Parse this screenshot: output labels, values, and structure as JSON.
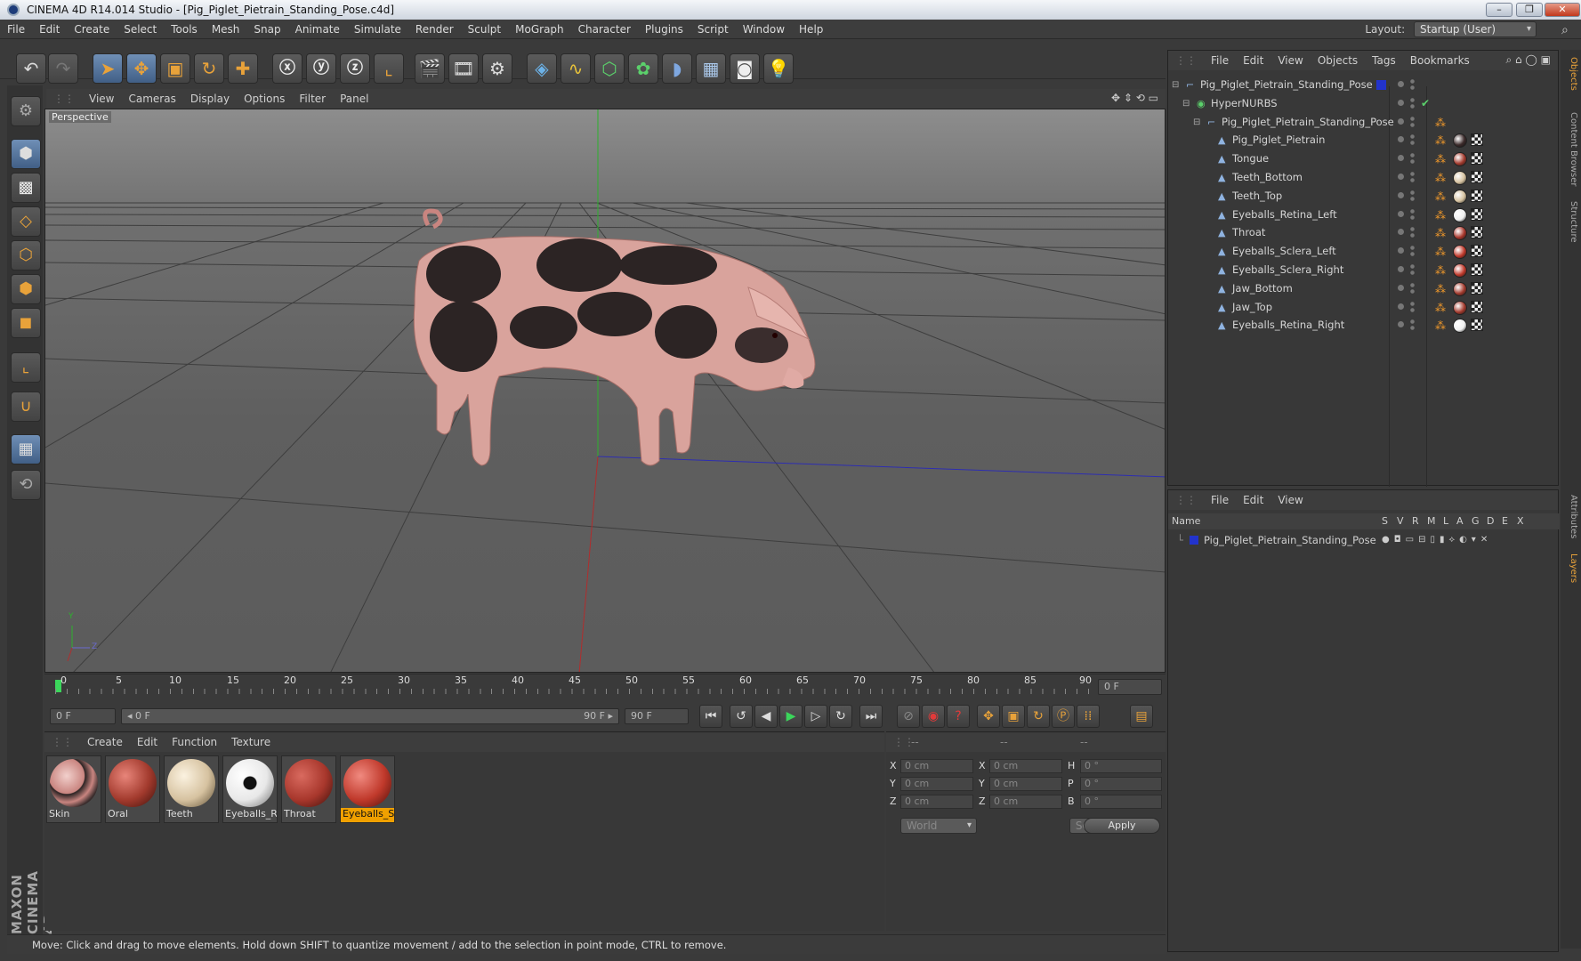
{
  "window": {
    "title": "CINEMA 4D R14.014 Studio - [Pig_Piglet_Pietrain_Standing_Pose.c4d]",
    "min": "–",
    "max": "❐",
    "close": "✕"
  },
  "menu": [
    "File",
    "Edit",
    "Create",
    "Select",
    "Tools",
    "Mesh",
    "Snap",
    "Animate",
    "Simulate",
    "Render",
    "Sculpt",
    "MoGraph",
    "Character",
    "Plugins",
    "Script",
    "Window",
    "Help"
  ],
  "layout": {
    "label": "Layout:",
    "value": "Startup (User)"
  },
  "viewport": {
    "menu": [
      "View",
      "Cameras",
      "Display",
      "Options",
      "Filter",
      "Panel"
    ],
    "label": "Perspective",
    "axis_y": "Y",
    "axis_z": "Z"
  },
  "timeline": {
    "ticks": [
      "0",
      "5",
      "10",
      "15",
      "20",
      "25",
      "30",
      "35",
      "40",
      "45",
      "50",
      "55",
      "60",
      "65",
      "70",
      "75",
      "80",
      "85",
      "90"
    ],
    "current_frame": "0 F",
    "start": "0 F",
    "range_start": "◂ 0 F",
    "range_end": "90 F ▸",
    "end": "90 F"
  },
  "materials": {
    "menu": [
      "Create",
      "Edit",
      "Function",
      "Texture"
    ],
    "items": [
      {
        "label": "Skin",
        "color": "#d9a5a0"
      },
      {
        "label": "Oral",
        "color": "#a23a2d"
      },
      {
        "label": "Teeth",
        "color": "#d6c2a0"
      },
      {
        "label": "Eyeballs_Re",
        "color": "#f0f0f0"
      },
      {
        "label": "Throat",
        "color": "#a8372c"
      },
      {
        "label": "Eyeballs_Sc",
        "color": "#c0392b"
      }
    ]
  },
  "coords": {
    "headers": [
      "--",
      "--",
      "--"
    ],
    "rows": [
      {
        "a": "X",
        "av": "0 cm",
        "b": "X",
        "bv": "0 cm",
        "c": "H",
        "cv": "0 °"
      },
      {
        "a": "Y",
        "av": "0 cm",
        "b": "Y",
        "bv": "0 cm",
        "c": "P",
        "cv": "0 °"
      },
      {
        "a": "Z",
        "av": "0 cm",
        "b": "Z",
        "bv": "0 cm",
        "c": "B",
        "cv": "0 °"
      }
    ],
    "world": "World",
    "scale": "Scale",
    "apply": "Apply"
  },
  "status": "Move: Click and drag to move elements. Hold down SHIFT to quantize movement / add to the selection in point mode, CTRL to remove.",
  "objects": {
    "menu": [
      "File",
      "Edit",
      "View",
      "Objects",
      "Tags",
      "Bookmarks"
    ],
    "tree": [
      {
        "name": "Pig_Piglet_Pietrain_Standing_Pose",
        "level": 0,
        "icon": "null"
      },
      {
        "name": "HyperNURBS",
        "level": 1,
        "icon": "nurbs"
      },
      {
        "name": "Pig_Piglet_Pietrain_Standing_Pose",
        "level": 2,
        "icon": "null"
      },
      {
        "name": "Pig_Piglet_Pietrain",
        "level": 3,
        "icon": "poly",
        "mat": "#3b2a2a"
      },
      {
        "name": "Tongue",
        "level": 3,
        "icon": "poly",
        "mat": "#a23a2d"
      },
      {
        "name": "Teeth_Bottom",
        "level": 3,
        "icon": "poly",
        "mat": "#d6c2a0"
      },
      {
        "name": "Teeth_Top",
        "level": 3,
        "icon": "poly",
        "mat": "#d6c2a0"
      },
      {
        "name": "Eyeballs_Retina_Left",
        "level": 3,
        "icon": "poly",
        "mat": "#f0f0f0"
      },
      {
        "name": "Throat",
        "level": 3,
        "icon": "poly",
        "mat": "#a8372c"
      },
      {
        "name": "Eyeballs_Sclera_Left",
        "level": 3,
        "icon": "poly",
        "mat": "#c0392b"
      },
      {
        "name": "Eyeballs_Sclera_Right",
        "level": 3,
        "icon": "poly",
        "mat": "#c0392b"
      },
      {
        "name": "Jaw_Bottom",
        "level": 3,
        "icon": "poly",
        "mat": "#a23a2d"
      },
      {
        "name": "Jaw_Top",
        "level": 3,
        "icon": "poly",
        "mat": "#a23a2d"
      },
      {
        "name": "Eyeballs_Retina_Right",
        "level": 3,
        "icon": "poly",
        "mat": "#f0f0f0"
      }
    ]
  },
  "attributes": {
    "menu": [
      "File",
      "Edit",
      "View"
    ],
    "columns": [
      "Name",
      "S",
      "V",
      "R",
      "M",
      "L",
      "A",
      "G",
      "D",
      "E",
      "X"
    ],
    "layer_name": "Pig_Piglet_Pietrain_Standing_Pose"
  },
  "right_tabs": [
    "Objects",
    "Content Browser",
    "Structure",
    "Attributes",
    "Layers"
  ],
  "logo": "MAXON CINEMA 4D"
}
